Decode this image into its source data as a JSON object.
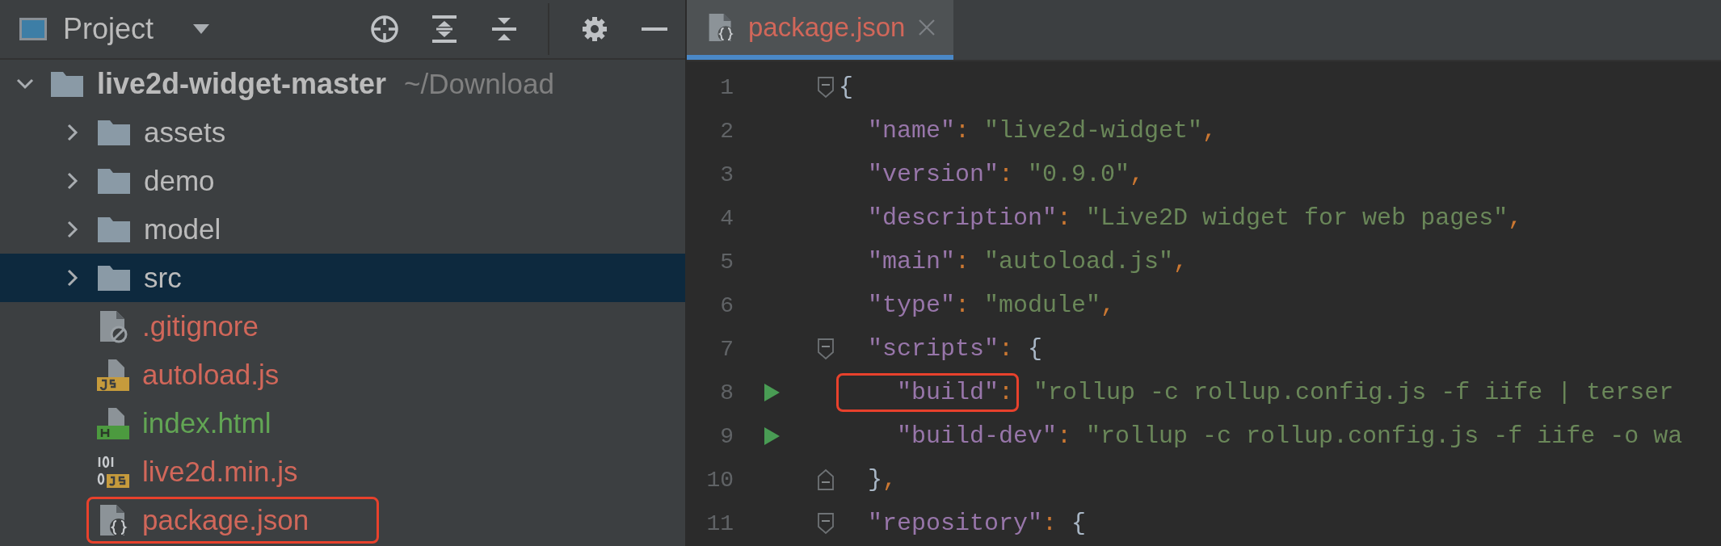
{
  "project_panel": {
    "title": "Project",
    "tree": [
      {
        "name": "live2d-widget-master",
        "path": "~/Download",
        "kind": "folder",
        "expanded": true,
        "selected": false,
        "boxed": false,
        "children": [
          {
            "name": "assets",
            "kind": "folder",
            "expanded": false,
            "selected": false,
            "boxed": false
          },
          {
            "name": "demo",
            "kind": "folder",
            "expanded": false,
            "selected": false,
            "boxed": false
          },
          {
            "name": "model",
            "kind": "folder",
            "expanded": false,
            "selected": false,
            "boxed": false
          },
          {
            "name": "src",
            "kind": "folder",
            "expanded": false,
            "selected": true,
            "boxed": false
          },
          {
            "name": ".gitignore",
            "kind": "ignore",
            "color": "#d1675a",
            "selected": false,
            "boxed": false
          },
          {
            "name": "autoload.js",
            "kind": "js",
            "color": "#d1675a",
            "selected": false,
            "boxed": false
          },
          {
            "name": "index.html",
            "kind": "html",
            "color": "#62a554",
            "selected": false,
            "boxed": false
          },
          {
            "name": "live2d.min.js",
            "kind": "minjs",
            "color": "#d1675a",
            "selected": false,
            "boxed": false
          },
          {
            "name": "package.json",
            "kind": "json",
            "color": "#d1675a",
            "selected": false,
            "boxed": true
          }
        ]
      }
    ]
  },
  "editor": {
    "tabs": [
      {
        "label": "package.json",
        "selected": true,
        "color": "#d1675a"
      }
    ],
    "lines": [
      {
        "number": "1",
        "fold_start": true,
        "fold_end": false,
        "run": false,
        "tokens": [
          {
            "kind": "punct",
            "text": "{"
          }
        ]
      },
      {
        "number": "2",
        "fold_start": false,
        "fold_end": false,
        "run": false,
        "tokens": [
          {
            "kind": "key",
            "text": "  \"name\""
          },
          {
            "kind": "sep",
            "text": ": "
          },
          {
            "kind": "string",
            "text": "\"live2d-widget\""
          },
          {
            "kind": "sep",
            "text": ","
          }
        ]
      },
      {
        "number": "3",
        "fold_start": false,
        "fold_end": false,
        "run": false,
        "tokens": [
          {
            "kind": "key",
            "text": "  \"version\""
          },
          {
            "kind": "sep",
            "text": ": "
          },
          {
            "kind": "string",
            "text": "\"0.9.0\""
          },
          {
            "kind": "sep",
            "text": ","
          }
        ]
      },
      {
        "number": "4",
        "fold_start": false,
        "fold_end": false,
        "run": false,
        "tokens": [
          {
            "kind": "key",
            "text": "  \"description\""
          },
          {
            "kind": "sep",
            "text": ": "
          },
          {
            "kind": "string",
            "text": "\"Live2D widget for web pages\""
          },
          {
            "kind": "sep",
            "text": ","
          }
        ]
      },
      {
        "number": "5",
        "fold_start": false,
        "fold_end": false,
        "run": false,
        "tokens": [
          {
            "kind": "key",
            "text": "  \"main\""
          },
          {
            "kind": "sep",
            "text": ": "
          },
          {
            "kind": "string",
            "text": "\"autoload.js\""
          },
          {
            "kind": "sep",
            "text": ","
          }
        ]
      },
      {
        "number": "6",
        "fold_start": false,
        "fold_end": false,
        "run": false,
        "tokens": [
          {
            "kind": "key",
            "text": "  \"type\""
          },
          {
            "kind": "sep",
            "text": ": "
          },
          {
            "kind": "string",
            "text": "\"module\""
          },
          {
            "kind": "sep",
            "text": ","
          }
        ]
      },
      {
        "number": "7",
        "fold_start": true,
        "fold_end": false,
        "run": false,
        "tokens": [
          {
            "kind": "key",
            "text": "  \"scripts\""
          },
          {
            "kind": "sep",
            "text": ": "
          },
          {
            "kind": "punct",
            "text": "{"
          }
        ]
      },
      {
        "number": "8",
        "fold_start": false,
        "fold_end": false,
        "run": true,
        "tokens": [
          {
            "kind": "boxed",
            "tokens": [
              {
                "kind": "key",
                "text": "    \"build\""
              },
              {
                "kind": "sep",
                "text": ":"
              }
            ]
          },
          {
            "kind": "string",
            "text": " \"rollup -c rollup.config.js -f iife | terser"
          }
        ]
      },
      {
        "number": "9",
        "fold_start": false,
        "fold_end": false,
        "run": true,
        "tokens": [
          {
            "kind": "key",
            "text": "    \"build-dev\""
          },
          {
            "kind": "sep",
            "text": ": "
          },
          {
            "kind": "string",
            "text": "\"rollup -c rollup.config.js -f iife -o wa"
          }
        ]
      },
      {
        "number": "10",
        "fold_start": false,
        "fold_end": true,
        "run": false,
        "tokens": [
          {
            "kind": "punct",
            "text": "  }"
          },
          {
            "kind": "sep",
            "text": ","
          }
        ]
      },
      {
        "number": "11",
        "fold_start": true,
        "fold_end": false,
        "run": false,
        "tokens": [
          {
            "kind": "key",
            "text": "  \"repository\""
          },
          {
            "kind": "sep",
            "text": ": "
          },
          {
            "kind": "punct",
            "text": "{"
          }
        ]
      }
    ]
  }
}
